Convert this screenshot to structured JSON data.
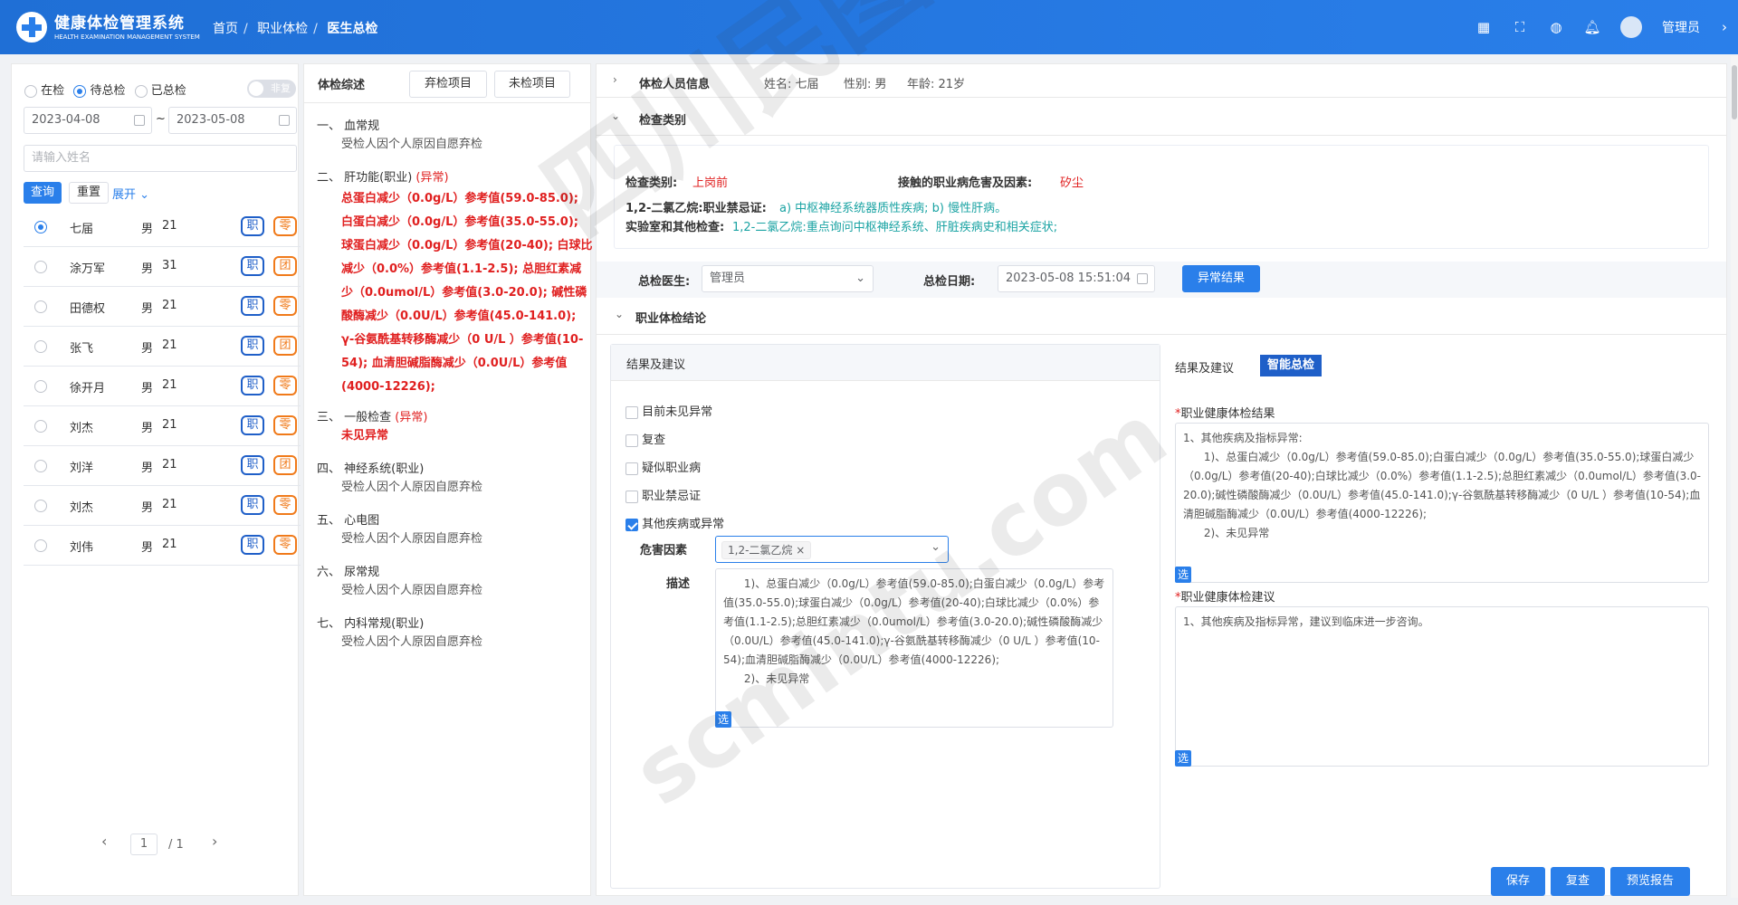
{
  "header": {
    "brand": "健康体检管理系统",
    "brand_sub": "HEALTH EXAMINATION MANAGEMENT SYSTEM",
    "breadcrumb": [
      "首页",
      "职业体检",
      "医生总检"
    ],
    "user": "管理员"
  },
  "filter": {
    "status_options": [
      "在检",
      "待总检",
      "已总检"
    ],
    "status_selected": "待总检",
    "toggle_label": "非复",
    "date_from": "2023-04-08",
    "date_to": "2023-05-08",
    "date_sep": "~",
    "name_placeholder": "请输入姓名",
    "query_label": "查询",
    "reset_label": "重置",
    "expand_label": "展开"
  },
  "patients": [
    {
      "name": "七届",
      "sex": "男",
      "age": "21",
      "tag1": "职",
      "tag2": "零",
      "tag2_color": "orange",
      "selected": true
    },
    {
      "name": "涂万军",
      "sex": "男",
      "age": "31",
      "tag1": "职",
      "tag2": "团",
      "tag2_color": "orange",
      "selected": false
    },
    {
      "name": "田德权",
      "sex": "男",
      "age": "21",
      "tag1": "职",
      "tag2": "零",
      "tag2_color": "orange",
      "selected": false
    },
    {
      "name": "张飞",
      "sex": "男",
      "age": "21",
      "tag1": "职",
      "tag2": "团",
      "tag2_color": "orange",
      "selected": false
    },
    {
      "name": "徐开月",
      "sex": "男",
      "age": "21",
      "tag1": "职",
      "tag2": "零",
      "tag2_color": "orange",
      "selected": false
    },
    {
      "name": "刘杰",
      "sex": "男",
      "age": "21",
      "tag1": "职",
      "tag2": "零",
      "tag2_color": "orange",
      "selected": false
    },
    {
      "name": "刘洋",
      "sex": "男",
      "age": "21",
      "tag1": "职",
      "tag2": "团",
      "tag2_color": "orange",
      "selected": false
    },
    {
      "name": "刘杰",
      "sex": "男",
      "age": "21",
      "tag1": "职",
      "tag2": "零",
      "tag2_color": "orange",
      "selected": false
    },
    {
      "name": "刘伟",
      "sex": "男",
      "age": "21",
      "tag1": "职",
      "tag2": "零",
      "tag2_color": "orange",
      "selected": false
    }
  ],
  "pager": {
    "prev": "‹",
    "page": "1",
    "total": "/ 1",
    "next": "›"
  },
  "summary": {
    "title": "体检综述",
    "abandon_btn": "弃检项目",
    "unchecked_btn": "未检项目",
    "items": [
      {
        "head": "一、  血常规",
        "text": "受检人因个人原因自愿弃检"
      },
      {
        "head": "二、  肝功能(职业)",
        "flag": "(异常)",
        "abn": "总蛋白减少（0.0g/L）参考值(59.0-85.0); 白蛋白减少（0.0g/L）参考值(35.0-55.0); 球蛋白减少（0.0g/L）参考值(20-40); 白球比减少（0.0%）参考值(1.1-2.5); 总胆红素减少（0.0umol/L）参考值(3.0-20.0); 碱性磷酸酶减少（0.0U/L）参考值(45.0-141.0); γ-谷氨酰基转移酶减少（0 U/L ）参考值(10-54); 血清胆碱脂酶减少（0.0U/L）参考值(4000-12226);"
      },
      {
        "head": "三、  一般检查",
        "flag": "(异常)",
        "abn": "未见异常"
      },
      {
        "head": "四、  神经系统(职业)",
        "text": "受检人因个人原因自愿弃检"
      },
      {
        "head": "五、  心电图",
        "text": "受检人因个人原因自愿弃检"
      },
      {
        "head": "六、  尿常规",
        "text": "受检人因个人原因自愿弃检"
      },
      {
        "head": "七、  内科常规(职业)",
        "text": "受检人因个人原因自愿弃检"
      }
    ]
  },
  "person": {
    "title": "体检人员信息",
    "name": "姓名: 七届",
    "sex": "性别: 男",
    "age": "年龄: 21岁"
  },
  "category": {
    "title": "检查类别",
    "type_label": "检查类别:",
    "type_value": "上岗前",
    "hazard_label": "接触的职业病危害及因素:",
    "hazard_value": "矽尘",
    "line1_label": "1,2-二氯乙烷:职业禁忌证:",
    "line1_value": "a) 中枢神经系统器质性疾病;   b) 慢性肝病。",
    "line2_label": "实验室和其他检查:",
    "line2_value": "1,2-二氯乙烷:重点询问中枢神经系统、肝脏疾病史和相关症状;"
  },
  "doctor": {
    "doctor_label": "总检医生:",
    "doctor_value": "管理员",
    "date_label": "总检日期:",
    "date_value": "2023-05-08 15:51:04",
    "abnormal_btn": "异常结果"
  },
  "conclusion": {
    "title": "职业体检结论",
    "left_title": "结果及建议",
    "checks": [
      {
        "label": "目前未见异常",
        "checked": false
      },
      {
        "label": "复查",
        "checked": false
      },
      {
        "label": "疑似职业病",
        "checked": false
      },
      {
        "label": "职业禁忌证",
        "checked": false
      },
      {
        "label": "其他疾病或异常",
        "checked": true
      }
    ],
    "hazard_label": "危害因素",
    "hazard_tag": "1,2-二氯乙烷",
    "desc_label": "描述",
    "desc_text": "      1)、总蛋白减少（0.0g/L）参考值(59.0-85.0);白蛋白减少（0.0g/L）参考值(35.0-55.0);球蛋白减少（0.0g/L）参考值(20-40);白球比减少（0.0%）参考值(1.1-2.5);总胆红素减少（0.0umol/L）参考值(3.0-20.0);碱性磷酸酶减少（0.0U/L）参考值(45.0-141.0);γ-谷氨酰基转移酶减少（0 U/L ）参考值(10-54);血清胆碱脂酶减少（0.0U/L）参考值(4000-12226);\n      2)、未见异常",
    "select_label": "选",
    "right_tab1": "结果及建议",
    "right_tab2": "智能总检",
    "result_label": "职业健康体检结果",
    "result_text": "1、其他疾病及指标异常:\n      1)、总蛋白减少（0.0g/L）参考值(59.0-85.0);白蛋白减少（0.0g/L）参考值(35.0-55.0);球蛋白减少（0.0g/L）参考值(20-40);白球比减少（0.0%）参考值(1.1-2.5);总胆红素减少（0.0umol/L）参考值(3.0-20.0);碱性磷酸酶减少（0.0U/L）参考值(45.0-141.0);γ-谷氨酰基转移酶减少（0 U/L ）参考值(10-54);血清胆碱脂酶减少（0.0U/L）参考值(4000-12226);\n      2)、未见异常",
    "advice_label": "职业健康体检建议",
    "advice_text": "1、其他疾病及指标异常，建议到临床进一步咨询。",
    "required_mark": "*"
  },
  "actions": {
    "save": "保存",
    "recheck": "复查",
    "preview": "预览报告"
  },
  "watermark": {
    "line1": "四川民图科技",
    "line2": "scmintu.com"
  },
  "colors": {
    "primary": "#2a7fea",
    "abnormal": "#e02020",
    "teal": "#1aa3a3"
  }
}
